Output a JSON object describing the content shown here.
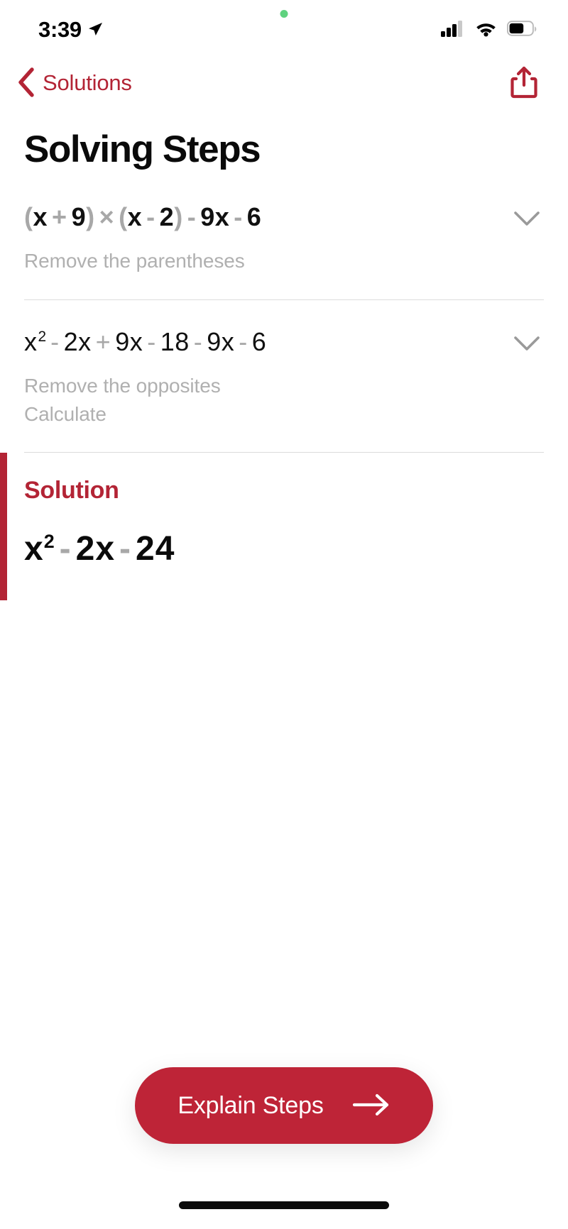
{
  "status_bar": {
    "time": "3:39",
    "location_icon": "location-arrow-icon",
    "privacy_icon": "green-privacy-dot",
    "cellular_icon": "cellular-signal-icon",
    "wifi_icon": "wifi-icon",
    "battery_icon": "battery-icon",
    "cellular_bars_filled": 3,
    "cellular_bars_total": 4,
    "battery_level_percent": 62
  },
  "nav_bar": {
    "back_label": "Solutions",
    "back_icon": "chevron-left-icon",
    "share_icon": "share-icon",
    "accent_color": "#B32435"
  },
  "header": {
    "title": "Solving Steps"
  },
  "steps": [
    {
      "id": "step-1",
      "expression_parts": [
        {
          "text": "(",
          "type": "paren"
        },
        {
          "text": "x",
          "type": "term"
        },
        {
          "text": "+",
          "type": "op"
        },
        {
          "text": "9",
          "type": "term"
        },
        {
          "text": ")",
          "type": "paren"
        },
        {
          "text": "×",
          "type": "op"
        },
        {
          "text": "(",
          "type": "paren"
        },
        {
          "text": "x",
          "type": "term"
        },
        {
          "text": "-",
          "type": "op"
        },
        {
          "text": "2",
          "type": "term"
        },
        {
          "text": ")",
          "type": "paren"
        },
        {
          "text": "-",
          "type": "op"
        },
        {
          "text": "9x",
          "type": "term"
        },
        {
          "text": "-",
          "type": "op"
        },
        {
          "text": "6",
          "type": "term"
        }
      ],
      "expression_plain": "(x+9)×(x-2)-9x-6",
      "hints": [
        "Remove the parentheses"
      ],
      "expand_icon": "chevron-down-icon"
    },
    {
      "id": "step-2",
      "expression_parts": [
        {
          "text": "x",
          "type": "term",
          "sup": "2"
        },
        {
          "text": "-",
          "type": "op"
        },
        {
          "text": "2x",
          "type": "term"
        },
        {
          "text": "+",
          "type": "op"
        },
        {
          "text": "9x",
          "type": "term"
        },
        {
          "text": "-",
          "type": "op"
        },
        {
          "text": "18",
          "type": "term"
        },
        {
          "text": "-",
          "type": "op"
        },
        {
          "text": "9x",
          "type": "term"
        },
        {
          "text": "-",
          "type": "op"
        },
        {
          "text": "6",
          "type": "term"
        }
      ],
      "expression_plain": "x²-2x+9x-18-9x-6",
      "hints": [
        "Remove the opposites",
        "Calculate"
      ],
      "expand_icon": "chevron-down-icon"
    }
  ],
  "solution": {
    "label": "Solution",
    "expression_plain": "x²-2x-24",
    "expression_parts": [
      {
        "text": "x",
        "type": "term",
        "sup": "2"
      },
      {
        "text": "-",
        "type": "op"
      },
      {
        "text": "2x",
        "type": "term"
      },
      {
        "text": "-",
        "type": "op"
      },
      {
        "text": "24",
        "type": "term"
      }
    ],
    "accent_color": "#B32435"
  },
  "cta": {
    "label": "Explain Steps",
    "arrow_icon": "arrow-right-icon",
    "background_color": "#BE2437"
  },
  "home_indicator": {
    "icon": "home-indicator-bar"
  }
}
